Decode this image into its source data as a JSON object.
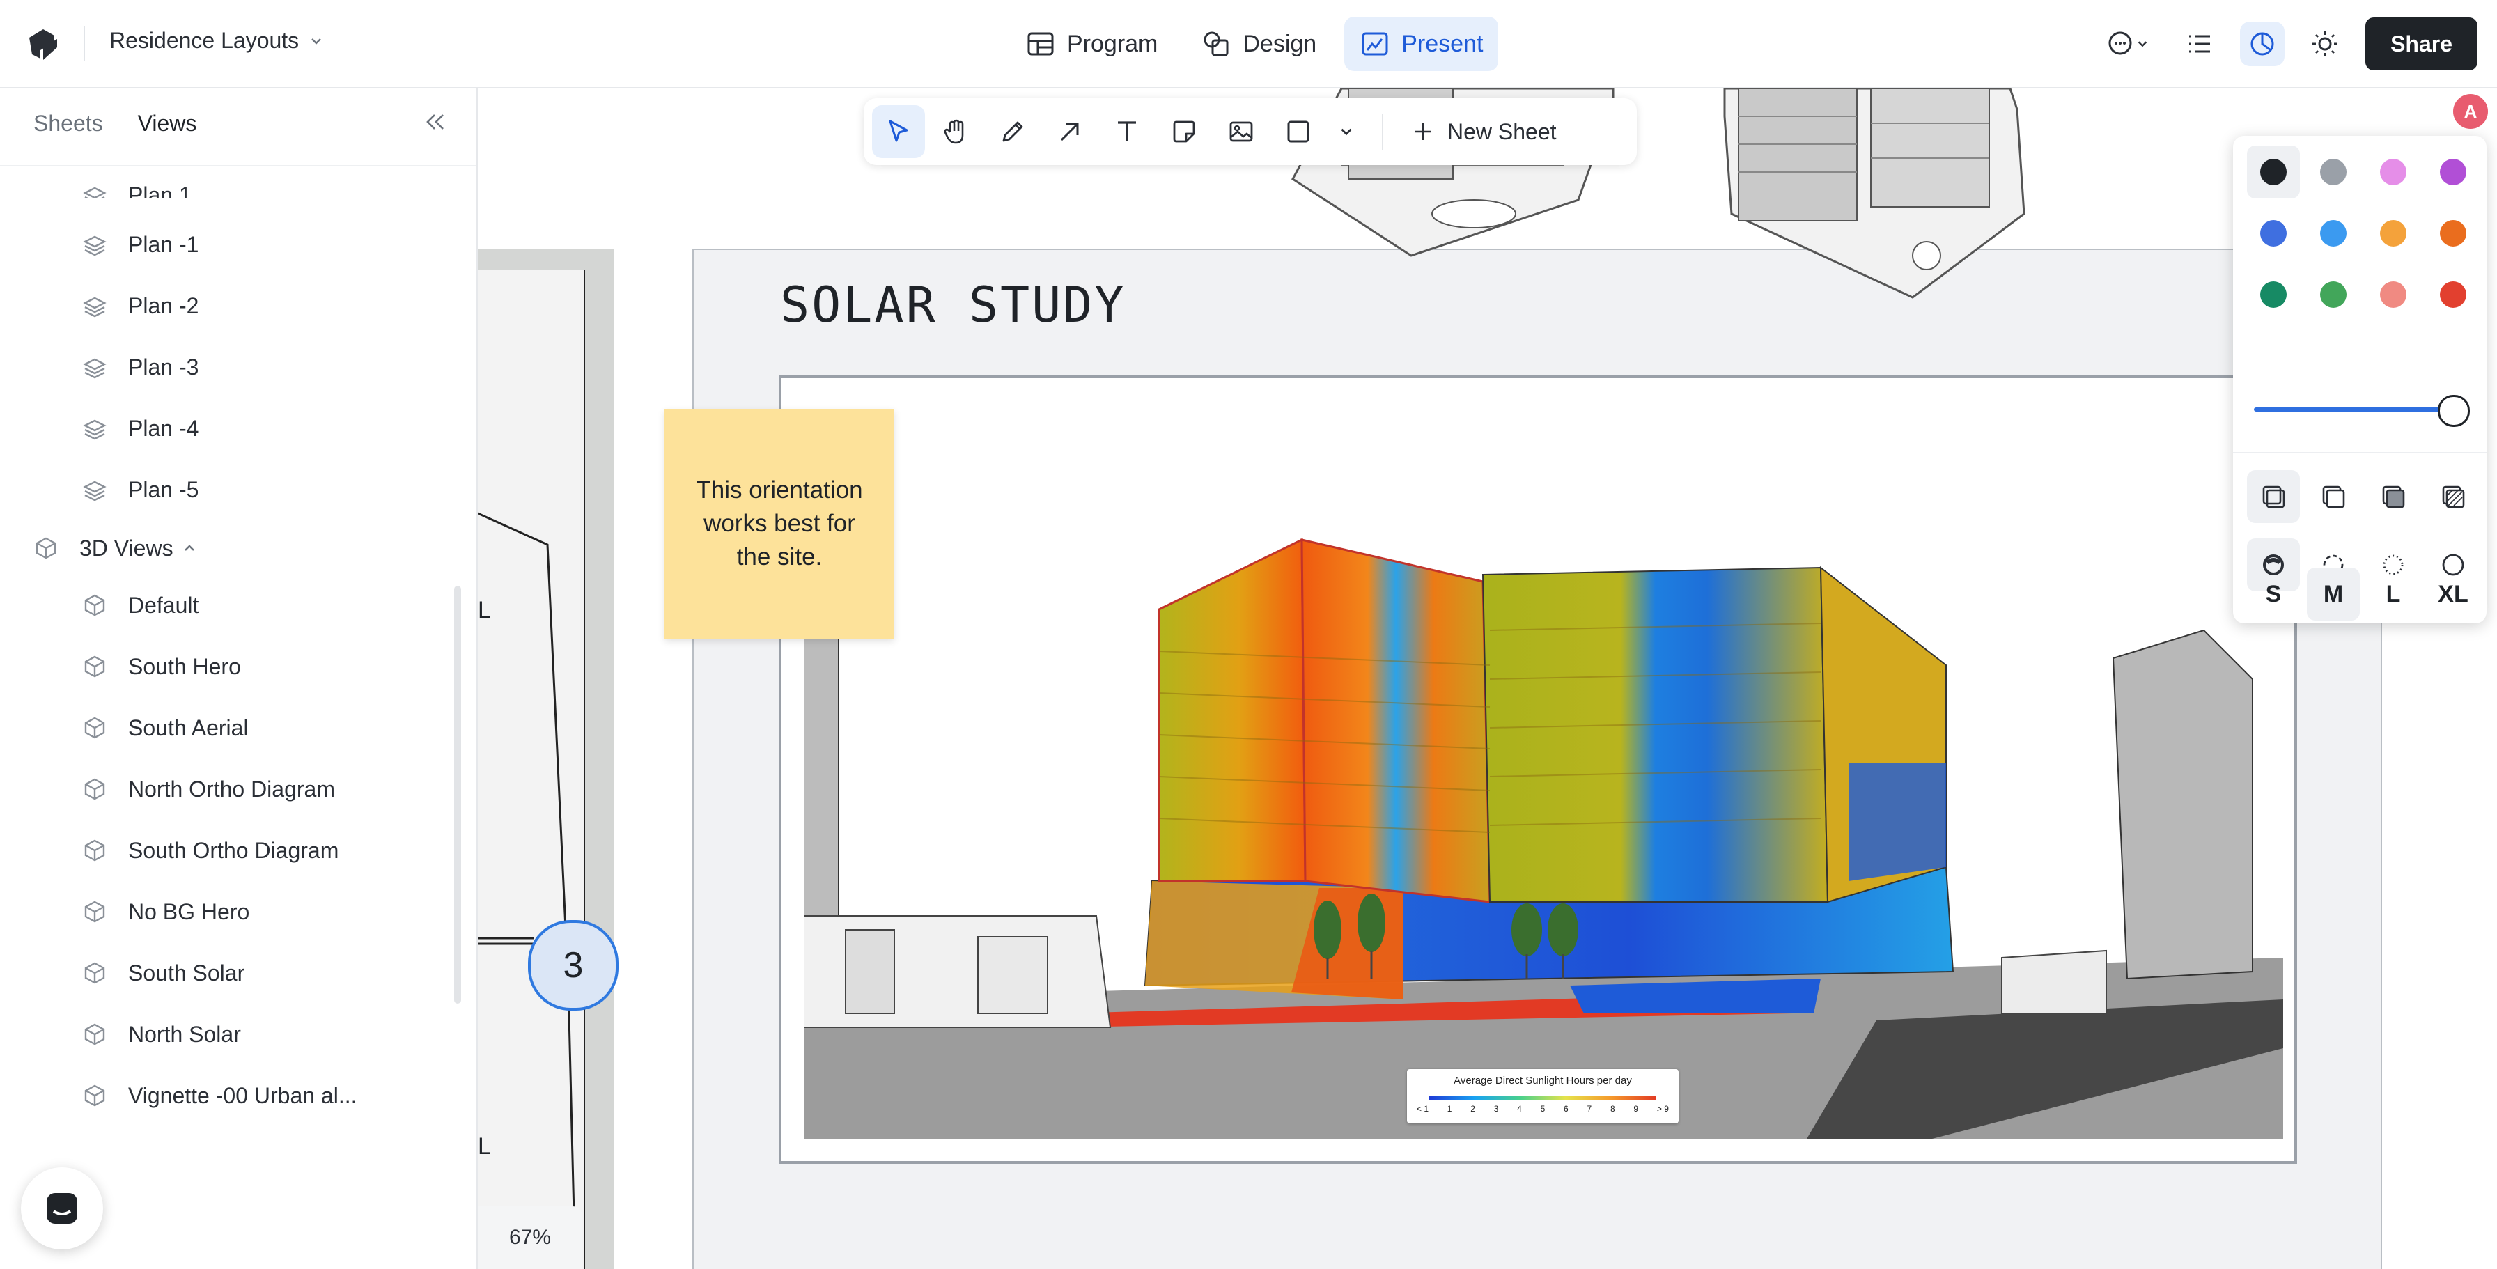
{
  "header": {
    "project_name": "Residence Layouts",
    "modes": [
      {
        "label": "Program",
        "active": false
      },
      {
        "label": "Design",
        "active": false
      },
      {
        "label": "Present",
        "active": true
      }
    ],
    "share_label": "Share"
  },
  "sidebar": {
    "tabs": [
      {
        "label": "Sheets",
        "active": false
      },
      {
        "label": "Views",
        "active": true
      }
    ],
    "plans": [
      "Plan 1",
      "Plan -1",
      "Plan -2",
      "Plan -3",
      "Plan -4",
      "Plan -5"
    ],
    "group_label": "3D Views",
    "views": [
      "Default",
      "South Hero",
      "South Aerial",
      "North Ortho Diagram",
      "South Ortho Diagram",
      "No BG Hero",
      "South Solar",
      "North Solar",
      "Vignette -00 Urban al..."
    ]
  },
  "toolbar": {
    "new_sheet_label": "New Sheet"
  },
  "canvas": {
    "page_title": "SOLAR STUDY",
    "sticky_note": "This orientation works best for the site.",
    "callout_number": "3",
    "zoom": "67%",
    "left_sheet_marks": [
      "L",
      "L"
    ],
    "legend": {
      "title": "Average Direct Sunlight Hours per day",
      "ticks": [
        "< 1",
        "1",
        "2",
        "3",
        "4",
        "5",
        "6",
        "7",
        "8",
        "9",
        "> 9"
      ]
    }
  },
  "style_panel": {
    "avatar_initial": "A",
    "colors": [
      "#1f2328",
      "#9aa0a8",
      "#e58ee8",
      "#b14fd6",
      "#3f6fe0",
      "#3b9af0",
      "#f4a23b",
      "#ea6d1e",
      "#178a64",
      "#42a65a",
      "#f08a82",
      "#e2402f"
    ],
    "selected_color": 0,
    "opacity_percent": 100,
    "sizes": [
      "S",
      "M",
      "L",
      "XL"
    ],
    "selected_size": "M"
  }
}
